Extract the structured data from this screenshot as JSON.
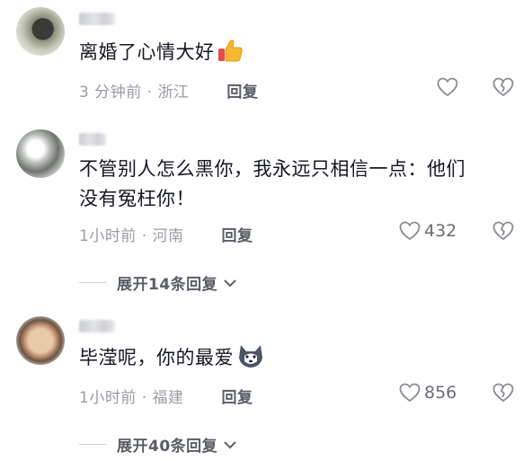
{
  "comments": [
    {
      "text": "离婚了心情大好",
      "emoji": "thumbs-up-icon",
      "time": "3 分钟前",
      "location": "浙江",
      "reply_label": "回复",
      "likes": ""
    },
    {
      "text_line1": "不管别人怎么黑你，我永远只相信一点：他们",
      "text_line2": "没有冤枉你！",
      "time": "1小时前",
      "location": "河南",
      "reply_label": "回复",
      "likes": "432",
      "expand_label": "展开14条回复"
    },
    {
      "text": "毕滢呢，你的最爱",
      "emoji": "husky-dog-icon",
      "time": "1小时前",
      "location": "福建",
      "reply_label": "回复",
      "likes": "856",
      "expand_label": "展开40条回复"
    }
  ],
  "separator": "·"
}
